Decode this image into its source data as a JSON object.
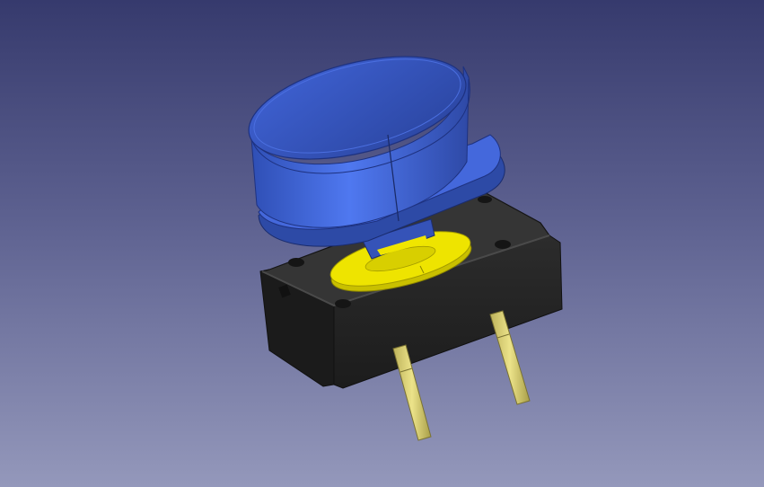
{
  "viewport": {
    "background_top": "#363a6d",
    "background_bottom": "#9498bb"
  },
  "model": {
    "cap_color": "#4a6fe6",
    "cap_shade_color": "#3350b3",
    "cap_dark_color": "#243a8a",
    "body_color": "#262626",
    "body_top_color": "#3a3a3a",
    "plunger_color": "#e8e000",
    "pin_color": "#d8cf73"
  }
}
